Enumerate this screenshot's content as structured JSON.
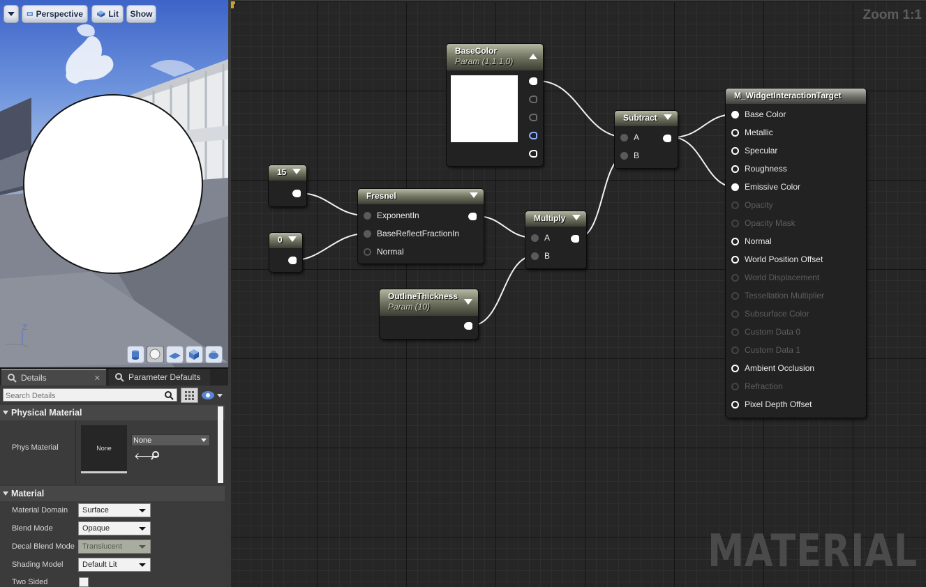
{
  "viewport": {
    "menu_label": "",
    "perspective_label": "Perspective",
    "lit_label": "Lit",
    "show_label": "Show",
    "axis_z": "Z"
  },
  "details": {
    "tabs": [
      {
        "label": "Details"
      },
      {
        "label": "Parameter Defaults"
      }
    ],
    "search_placeholder": "Search Details",
    "physical_material": {
      "header": "Physical Material",
      "phys_material_label": "Phys Material",
      "thumbnail_text": "None",
      "combo_value": "None"
    },
    "material": {
      "header": "Material",
      "rows": [
        {
          "label": "Material Domain",
          "value": "Surface"
        },
        {
          "label": "Blend Mode",
          "value": "Opaque"
        },
        {
          "label": "Decal Blend Mode",
          "value": "Translucent"
        },
        {
          "label": "Shading Model",
          "value": "Default Lit"
        }
      ],
      "two_sided_label": "Two Sided"
    }
  },
  "graph": {
    "zoom": "Zoom 1:1",
    "watermark": "MATERIAL",
    "nodes": {
      "basecolor": {
        "title": "BaseColor",
        "subtitle": "Param (1,1,1,0)"
      },
      "const15": {
        "title": "15"
      },
      "const0": {
        "title": "0"
      },
      "fresnel": {
        "title": "Fresnel",
        "pins": [
          "ExponentIn",
          "BaseReflectFractionIn",
          "Normal"
        ]
      },
      "outline": {
        "title": "OutlineThickness",
        "subtitle": "Param (10)"
      },
      "multiply": {
        "title": "Multiply",
        "pins": [
          "A",
          "B"
        ]
      },
      "subtract": {
        "title": "Subtract",
        "pins": [
          "A",
          "B"
        ]
      },
      "result": {
        "title": "M_WidgetInteractionTarget",
        "pins": [
          "Base Color",
          "Metallic",
          "Specular",
          "Roughness",
          "Emissive Color",
          "Opacity",
          "Opacity Mask",
          "Normal",
          "World Position Offset",
          "World Displacement",
          "Tessellation Multiplier",
          "Subsurface Color",
          "Custom Data 0",
          "Custom Data 1",
          "Ambient Occlusion",
          "Refraction",
          "Pixel Depth Offset"
        ]
      }
    }
  }
}
